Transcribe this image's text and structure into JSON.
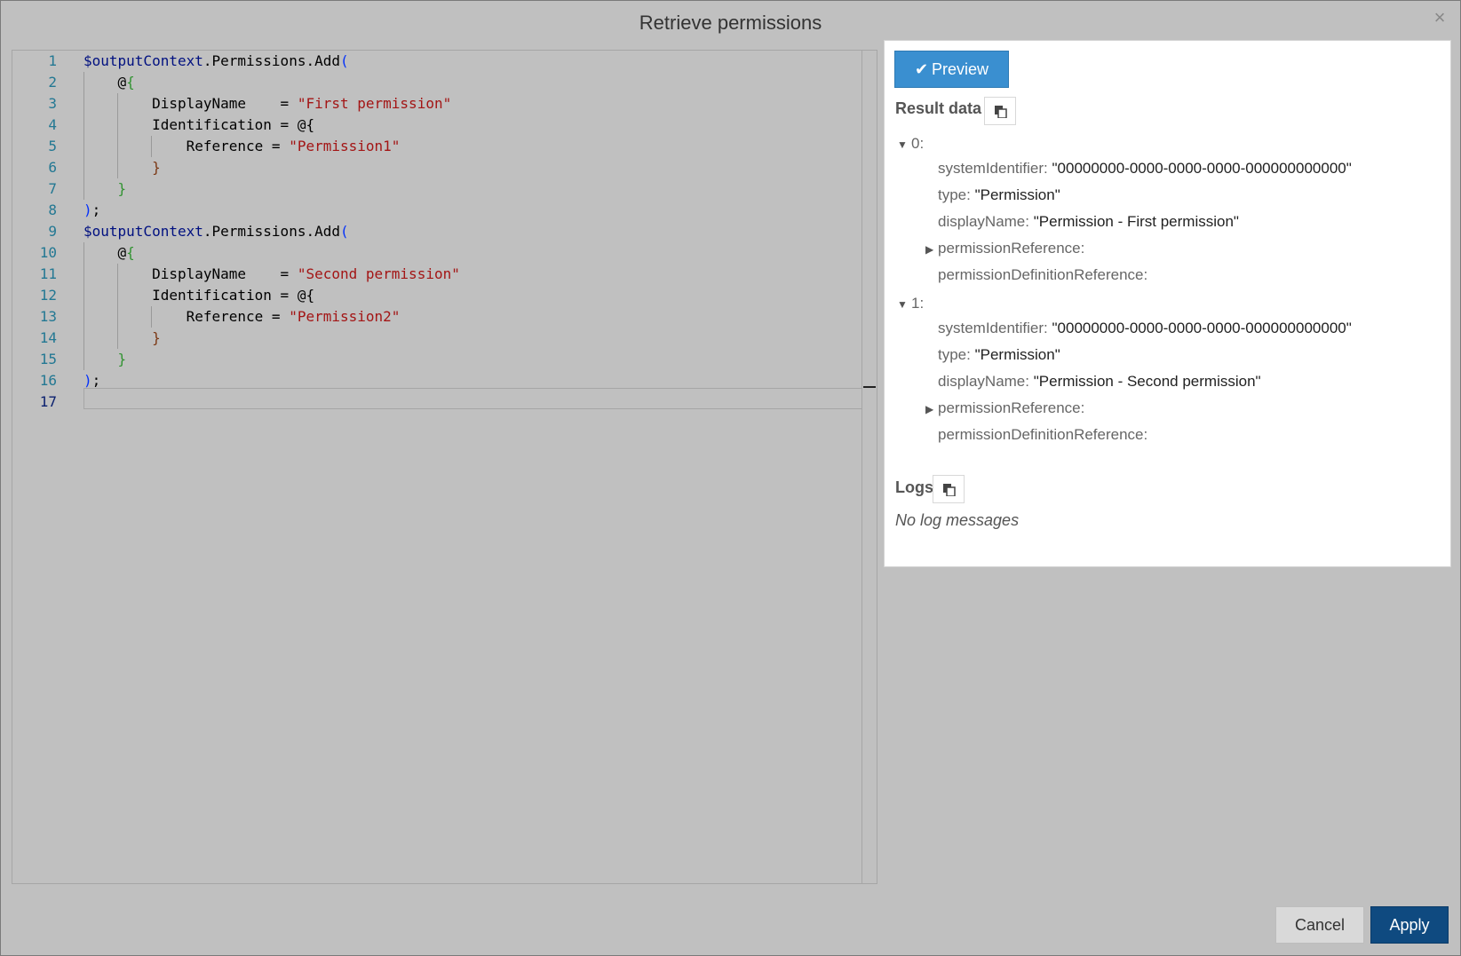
{
  "dialog": {
    "title": "Retrieve permissions",
    "close_symbol": "×"
  },
  "editor": {
    "line_numbers": [
      "1",
      "2",
      "3",
      "4",
      "5",
      "6",
      "7",
      "8",
      "9",
      "10",
      "11",
      "12",
      "13",
      "14",
      "15",
      "16",
      "17"
    ],
    "lines": [
      [
        {
          "t": "$outputContext",
          "c": "v"
        },
        {
          "t": ".Permissions.Add",
          "c": ""
        },
        {
          "t": "(",
          "c": "p1"
        }
      ],
      [
        {
          "t": "    ",
          "c": ""
        },
        {
          "t": "@",
          "c": ""
        },
        {
          "t": "{",
          "c": "p2"
        }
      ],
      [
        {
          "t": "        DisplayName    = ",
          "c": ""
        },
        {
          "t": "\"First permission\"",
          "c": "s"
        }
      ],
      [
        {
          "t": "        Identification = ",
          "c": ""
        },
        {
          "t": "@{",
          "c": ""
        }
      ],
      [
        {
          "t": "            Reference = ",
          "c": ""
        },
        {
          "t": "\"Permission1\"",
          "c": "s"
        }
      ],
      [
        {
          "t": "        ",
          "c": ""
        },
        {
          "t": "}",
          "c": "p3"
        }
      ],
      [
        {
          "t": "    ",
          "c": ""
        },
        {
          "t": "}",
          "c": "p2"
        }
      ],
      [
        {
          "t": ")",
          "c": "p1"
        },
        {
          "t": ";",
          "c": ""
        }
      ],
      [
        {
          "t": "$outputContext",
          "c": "v"
        },
        {
          "t": ".Permissions.Add",
          "c": ""
        },
        {
          "t": "(",
          "c": "p1"
        }
      ],
      [
        {
          "t": "    ",
          "c": ""
        },
        {
          "t": "@",
          "c": ""
        },
        {
          "t": "{",
          "c": "p2"
        }
      ],
      [
        {
          "t": "        DisplayName    = ",
          "c": ""
        },
        {
          "t": "\"Second permission\"",
          "c": "s"
        }
      ],
      [
        {
          "t": "        Identification = ",
          "c": ""
        },
        {
          "t": "@{",
          "c": ""
        }
      ],
      [
        {
          "t": "            Reference = ",
          "c": ""
        },
        {
          "t": "\"Permission2\"",
          "c": "s"
        }
      ],
      [
        {
          "t": "        ",
          "c": ""
        },
        {
          "t": "}",
          "c": "p3"
        }
      ],
      [
        {
          "t": "    ",
          "c": ""
        },
        {
          "t": "}",
          "c": "p2"
        }
      ],
      [
        {
          "t": ")",
          "c": "p1"
        },
        {
          "t": ";",
          "c": ""
        }
      ],
      [
        {
          "t": "",
          "c": ""
        }
      ]
    ]
  },
  "panel": {
    "preview_label": "Preview",
    "result_label": "Result data",
    "logs_label": "Logs",
    "no_logs": "No log messages",
    "results": [
      {
        "index": "0:",
        "systemIdentifier_key": "systemIdentifier:",
        "systemIdentifier": "\"00000000-0000-0000-0000-000000000000\"",
        "type_key": "type:",
        "type": "\"Permission\"",
        "displayName_key": "displayName:",
        "displayName": "\"Permission - First permission\"",
        "permissionReference_key": "permissionReference:",
        "permissionDefinitionReference_key": "permissionDefinitionReference:"
      },
      {
        "index": "1:",
        "systemIdentifier_key": "systemIdentifier:",
        "systemIdentifier": "\"00000000-0000-0000-0000-000000000000\"",
        "type_key": "type:",
        "type": "\"Permission\"",
        "displayName_key": "displayName:",
        "displayName": "\"Permission - Second permission\"",
        "permissionReference_key": "permissionReference:",
        "permissionDefinitionReference_key": "permissionDefinitionReference:"
      }
    ]
  },
  "footer": {
    "cancel_label": "Cancel",
    "apply_label": "Apply"
  },
  "colors": {
    "overlay": "#c0c0c0",
    "preview_button": "#3a8fd0",
    "apply_button": "#0f4a80",
    "string": "#a31515",
    "variable": "#001080"
  }
}
